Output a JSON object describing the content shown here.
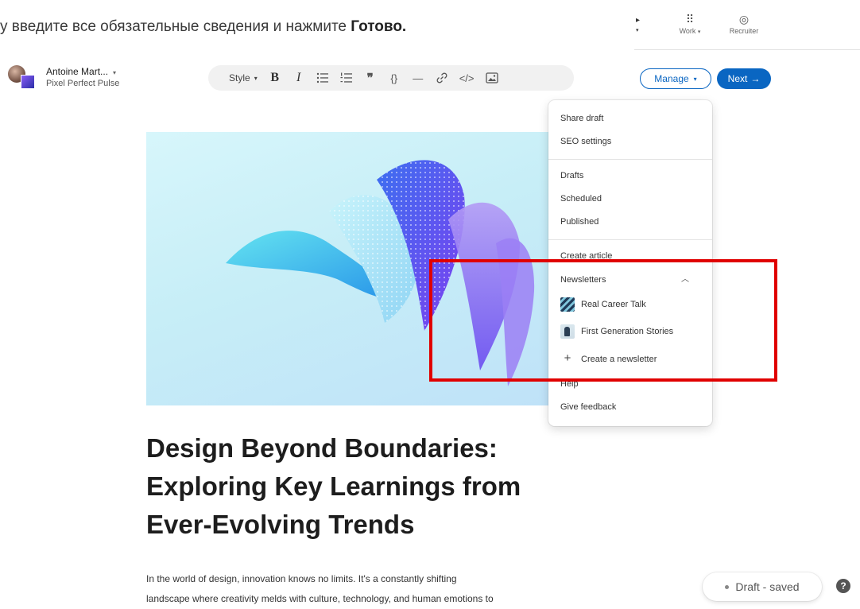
{
  "instruction": {
    "prefix": "у введите все обязательные сведения и нажмите ",
    "bold": "Готово."
  },
  "topnav": {
    "work_label": "Work",
    "recruiter_label": "Recruiter"
  },
  "author": {
    "name": "Antoine Mart...",
    "page": "Pixel Perfect Pulse"
  },
  "toolbar": {
    "style_label": "Style",
    "bold_glyph": "B",
    "italic_glyph": "I"
  },
  "actions": {
    "manage_label": "Manage",
    "next_label": "Next"
  },
  "menu": {
    "share_draft": "Share draft",
    "seo_settings": "SEO settings",
    "drafts": "Drafts",
    "scheduled": "Scheduled",
    "published": "Published",
    "create_article": "Create article",
    "newsletters_header": "Newsletters",
    "newsletters": [
      {
        "label": "Real Career Talk"
      },
      {
        "label": "First Generation Stories"
      }
    ],
    "create_newsletter": "Create a newsletter",
    "help": "Help",
    "give_feedback": "Give feedback"
  },
  "article": {
    "title_line1": "Design Beyond Boundaries:",
    "title_line2": "Exploring Key Learnings from",
    "title_line3": "Ever-Evolving Trends",
    "body_line1": "In the world of design, innovation knows no limits. It's a constantly shifting",
    "body_line2": "landscape where creativity melds with culture, technology, and human emotions to"
  },
  "status": {
    "draft_label": "Draft - saved",
    "help_glyph": "?"
  },
  "colors": {
    "accent": "#0a66c2",
    "highlight": "#e00000"
  }
}
